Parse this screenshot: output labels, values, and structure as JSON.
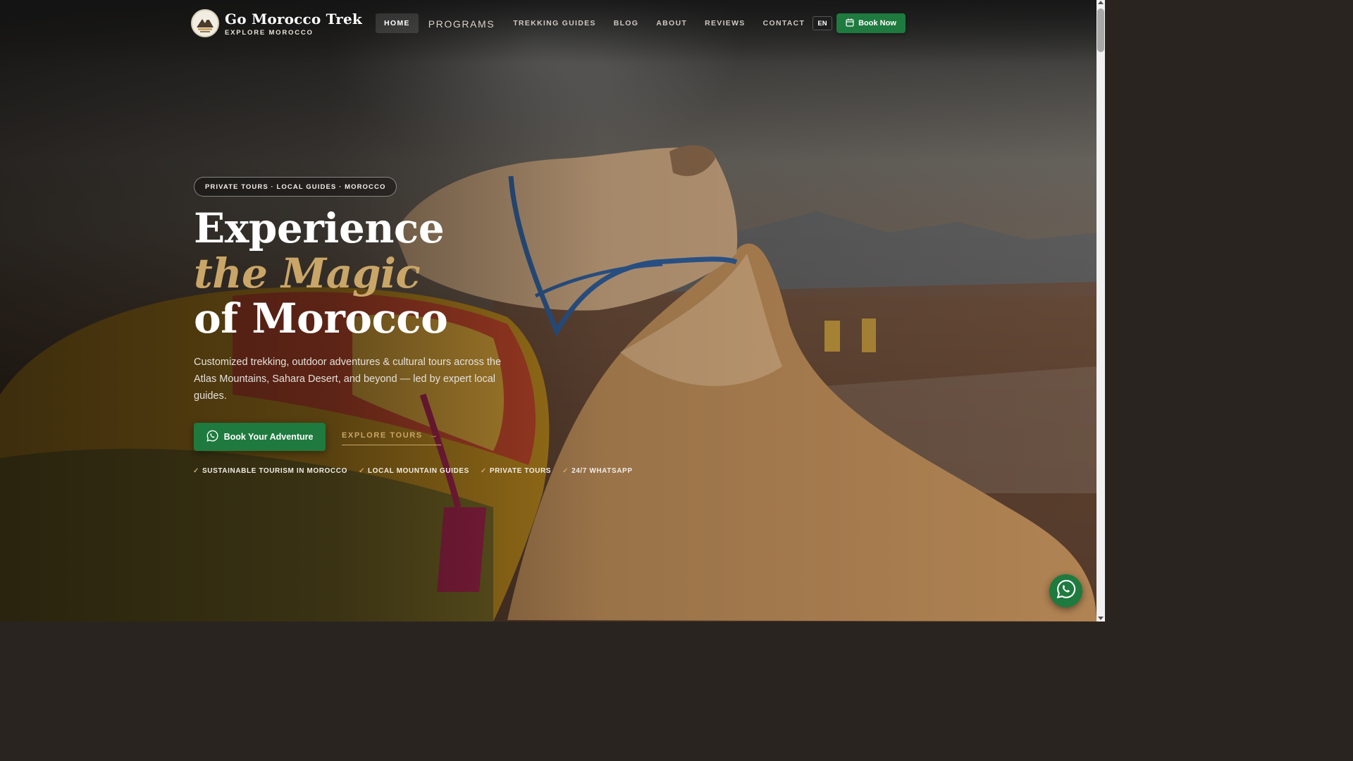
{
  "brand": {
    "title": "Go Morocco Trek",
    "subtitle": "EXPLORE MOROCCO",
    "logo_icon": "mountain-logo-icon"
  },
  "nav": {
    "items": [
      {
        "label": "HOME",
        "active": true
      },
      {
        "label": "PROGRAMS",
        "active": false
      },
      {
        "label": "TREKKING GUIDES",
        "active": false
      },
      {
        "label": "BLOG",
        "active": false
      },
      {
        "label": "ABOUT",
        "active": false
      },
      {
        "label": "REVIEWS",
        "active": false
      },
      {
        "label": "CONTACT",
        "active": false
      }
    ],
    "language": "EN",
    "book_now": "Book Now",
    "book_now_icon": "calendar-icon"
  },
  "hero": {
    "badge": "PRIVATE TOURS · LOCAL GUIDES · MOROCCO",
    "headline": {
      "line1": "Experience",
      "line2": "the Magic",
      "line3": "of Morocco"
    },
    "description": "Customized trekking, outdoor adventures & cultural tours across the Atlas Mountains, Sahara Desert, and beyond — led by expert local guides.",
    "cta_primary": "Book Your Adventure",
    "cta_primary_icon": "whatsapp-icon",
    "cta_secondary": "EXPLORE TOURS",
    "cta_secondary_arrow": "→",
    "features": [
      "SUSTAINABLE TOURISM IN MOROCCO",
      "LOCAL MOUNTAIN GUIDES",
      "PRIVATE TOURS",
      "24/7 WHATSAPP"
    ],
    "feature_check": "✓"
  },
  "floating": {
    "whatsapp_icon": "whatsapp-icon"
  },
  "colors": {
    "accent_gold": "#c9a668",
    "brand_green": "#1e7a3e"
  }
}
